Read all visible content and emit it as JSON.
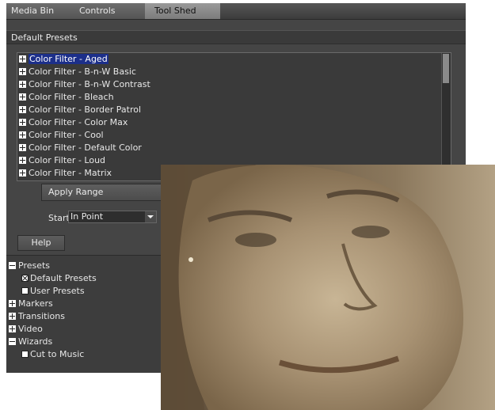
{
  "tabs": [
    {
      "label": "Media Bin"
    },
    {
      "label": "Controls"
    },
    {
      "label": "Tool Shed",
      "active": true
    }
  ],
  "section_title": "Default Presets",
  "presets": [
    {
      "label": "Color Filter - Aged",
      "selected": true
    },
    {
      "label": "Color Filter - B-n-W Basic"
    },
    {
      "label": "Color Filter - B-n-W Contrast"
    },
    {
      "label": "Color Filter - Bleach"
    },
    {
      "label": "Color Filter - Border Patrol"
    },
    {
      "label": "Color Filter - Color Max"
    },
    {
      "label": "Color Filter - Cool"
    },
    {
      "label": "Color Filter - Default Color"
    },
    {
      "label": "Color Filter - Loud"
    },
    {
      "label": "Color Filter - Matrix"
    }
  ],
  "apply_range_label": "Apply Range",
  "start": {
    "label": "Start",
    "value": "In Point"
  },
  "help_label": "Help",
  "tree": {
    "presets": "Presets",
    "default_presets": "Default Presets",
    "user_presets": "User Presets",
    "markers": "Markers",
    "transitions": "Transitions",
    "video": "Video",
    "wizards": "Wizards",
    "cut_to_music": "Cut to Music"
  },
  "colors": {
    "selection": "#1c2f8a",
    "panel": "#454545",
    "sepia": "#9a8566"
  }
}
